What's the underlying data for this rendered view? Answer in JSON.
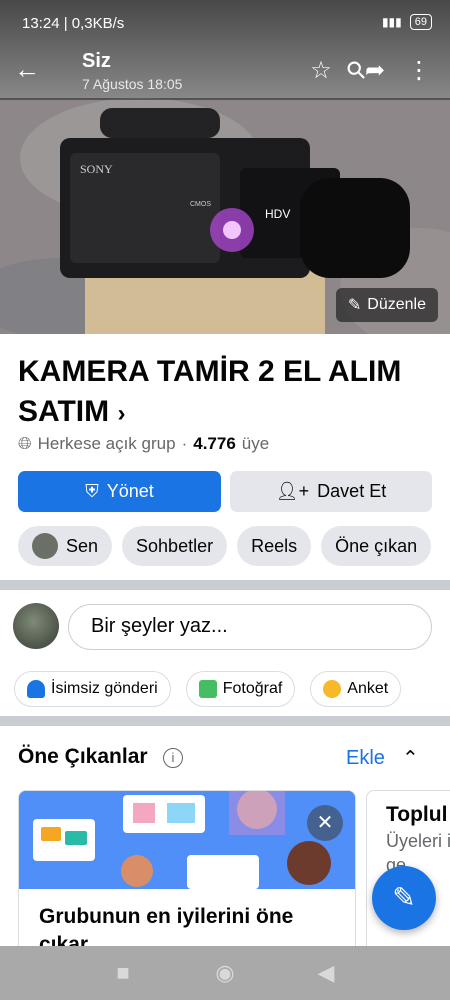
{
  "status_bar": {
    "time": "13:24",
    "speed": "0,3KB/s",
    "battery": "69"
  },
  "header": {
    "title": "Siz",
    "subtitle": "7 Ağustos 18:05",
    "back_icon": "arrow-left-icon",
    "icons": [
      "star-icon",
      "search-icon",
      "share-icon",
      "shield-menu-icon"
    ]
  },
  "cover": {
    "edit_label": "Düzenle",
    "camera_brand": "SONY",
    "camera_badge": "HDV",
    "camera_cmos": "CMOS"
  },
  "group": {
    "name": "KAMERA TAMİR 2 EL ALIM SATIM",
    "chevron": "›",
    "privacy": "Herkese açık grup",
    "separator": "·",
    "member_count": "4.776",
    "member_label": "üye"
  },
  "buttons": {
    "manage": "Yönet",
    "invite": "Davet Et"
  },
  "chips": [
    {
      "label": "Sen"
    },
    {
      "label": "Sohbetler"
    },
    {
      "label": "Reels"
    },
    {
      "label": "Öne çıkan"
    }
  ],
  "composer": {
    "placeholder": "Bir şeyler yaz..."
  },
  "post_actions": [
    {
      "label": "İsimsiz gönderi",
      "icon": "anonymous-icon",
      "color": "#1b74e4"
    },
    {
      "label": "Fotoğraf",
      "icon": "photo-icon",
      "color": "#45bd62"
    },
    {
      "label": "Anket",
      "icon": "poll-icon",
      "color": "#f7b928"
    }
  ],
  "highlights": {
    "title": "Öne Çıkanlar",
    "add": "Ekle",
    "card1_title": "Grubunun en iyilerini öne çıkar",
    "card2_title": "Toplul",
    "card2_sub": "Üyeleri iyi ge"
  },
  "colors": {
    "accent": "#1b74e4",
    "chip_bg": "#e4e6eb",
    "divider": "#c9ccd1"
  }
}
